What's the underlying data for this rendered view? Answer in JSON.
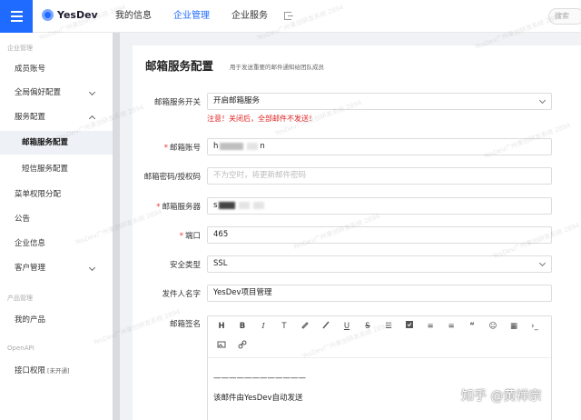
{
  "topbar": {
    "logo": "YesDev",
    "nav": [
      "我的信息",
      "企业管理",
      "企业服务"
    ],
    "active_nav": "企业管理",
    "search_placeholder": "搜索"
  },
  "sidebar": {
    "groups": [
      "企业管理",
      "产品管理",
      "OpenAPI"
    ],
    "items": [
      {
        "label": "成员账号"
      },
      {
        "label": "全局偏好配置"
      },
      {
        "label": "服务配置"
      },
      {
        "label": "邮箱服务配置"
      },
      {
        "label": "短信服务配置"
      },
      {
        "label": "菜单权限分配"
      },
      {
        "label": "公告"
      },
      {
        "label": "企业信息"
      },
      {
        "label": "客户管理"
      },
      {
        "label": "我的产品"
      },
      {
        "label": "接口权限"
      }
    ],
    "api_tag": "[未开通]"
  },
  "form": {
    "title": "邮箱服务配置",
    "subtitle": "用于发送重要的邮件通知给团队成员",
    "switch_label": "邮箱服务开关",
    "switch_value": "开启邮箱服务",
    "warning": "注意！关闭后，全部邮件不发送！",
    "account_label": "邮箱账号",
    "account_value_start": "h",
    "account_value_end": "n",
    "password_label": "邮箱密码/授权码",
    "password_placeholder": "不为空时，将更新邮件密码",
    "server_label": "邮箱服务器",
    "server_value_start": "s",
    "port_label": "端口",
    "port_value": "465",
    "security_label": "安全类型",
    "security_value": "SSL",
    "sender_label": "发件人名字",
    "sender_value": "YesDev项目管理",
    "signature_label": "邮箱签名",
    "toolbar_text": [
      "H",
      "B",
      "I",
      "T",
      "S",
      "“",
      "›_"
    ],
    "signature_line1": "————————————",
    "signature_line2": "该邮件由YesDev自动发送"
  },
  "watermark": {
    "text": "YesDev广州果创研发系统 2894"
  },
  "footer_watermark": "知乎 @黄禅宗",
  "colors": {
    "accent": "#1f6bff",
    "warning": "#e02020"
  }
}
